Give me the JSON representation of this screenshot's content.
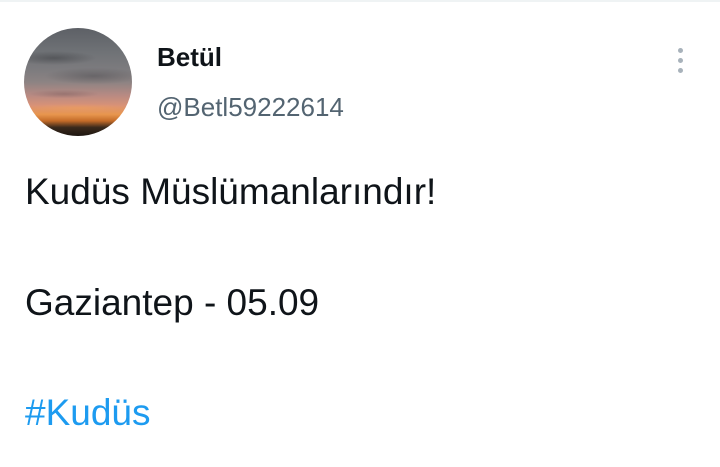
{
  "tweet": {
    "author": {
      "display_name": "Betül",
      "handle": "@Betl59222614"
    },
    "text_lines": [
      "Kudüs Müslümanlarındır!",
      "Gaziantep - 05.09"
    ],
    "hashtag": "#Kudüs",
    "more_icon": "more-vertical-icon"
  },
  "colors": {
    "text_primary": "#0f1419",
    "text_secondary": "#536471",
    "link": "#1d9bf0",
    "icon_muted": "#a8b2bb"
  }
}
